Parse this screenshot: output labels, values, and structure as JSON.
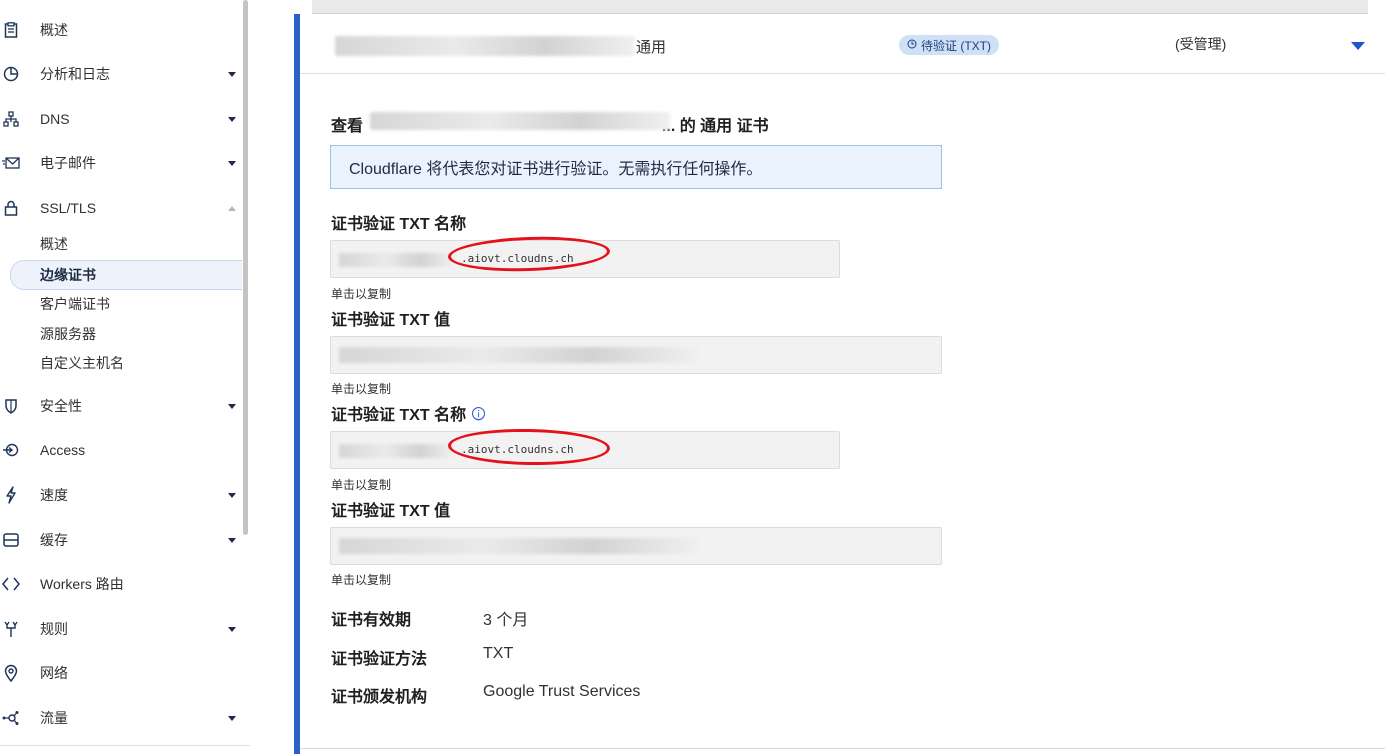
{
  "sidebar": {
    "items": [
      {
        "label": "概述",
        "icon": "clipboard-icon"
      },
      {
        "label": "分析和日志",
        "icon": "pie-chart-icon"
      },
      {
        "label": "DNS",
        "icon": "network-icon"
      },
      {
        "label": "电子邮件",
        "icon": "envelope-icon"
      },
      {
        "label": "SSL/TLS",
        "icon": "lock-icon"
      },
      {
        "label": "安全性",
        "icon": "shield-icon"
      },
      {
        "label": "Access",
        "icon": "access-icon"
      },
      {
        "label": "速度",
        "icon": "lightning-icon"
      },
      {
        "label": "缓存",
        "icon": "cache-icon"
      },
      {
        "label": "Workers 路由",
        "icon": "workers-icon"
      },
      {
        "label": "规则",
        "icon": "rules-icon"
      },
      {
        "label": "网络",
        "icon": "location-pin-icon"
      },
      {
        "label": "流量",
        "icon": "traffic-icon"
      }
    ],
    "ssl_subitems": [
      {
        "label": "概述"
      },
      {
        "label": "边缘证书",
        "active": true
      },
      {
        "label": "客户端证书"
      },
      {
        "label": "源服务器"
      },
      {
        "label": "自定义主机名"
      }
    ]
  },
  "certificate_row": {
    "type": "通用",
    "status": "待验证 (TXT)",
    "managed": "(受管理)"
  },
  "panel": {
    "title_prefix": "查看",
    "title_suffix": "... 的 通用 证书",
    "banner": "Cloudflare 将代表您对证书进行验证。无需执行任何操作。",
    "fields": [
      {
        "label": "证书验证 TXT 名称",
        "value_visible": ".aiovt.cloudns.ch",
        "hint": "单击以复制"
      },
      {
        "label": "证书验证 TXT 值",
        "hint": "单击以复制"
      },
      {
        "label": "证书验证 TXT 名称",
        "value_visible": ".aiovt.cloudns.ch",
        "hint": "单击以复制",
        "info_icon": "ⓘ"
      },
      {
        "label": "证书验证 TXT 值",
        "hint": "单击以复制"
      }
    ],
    "details": [
      {
        "label": "证书有效期",
        "value": "3 个月"
      },
      {
        "label": "证书验证方法",
        "value": "TXT"
      },
      {
        "label": "证书颁发机构",
        "value": "Google Trust Services"
      }
    ]
  },
  "colors": {
    "accent": "#2b5fc9",
    "badge_bg": "#cfe0f7",
    "banner_bg": "#eaf3fd",
    "annotation_red": "#e4111b"
  }
}
